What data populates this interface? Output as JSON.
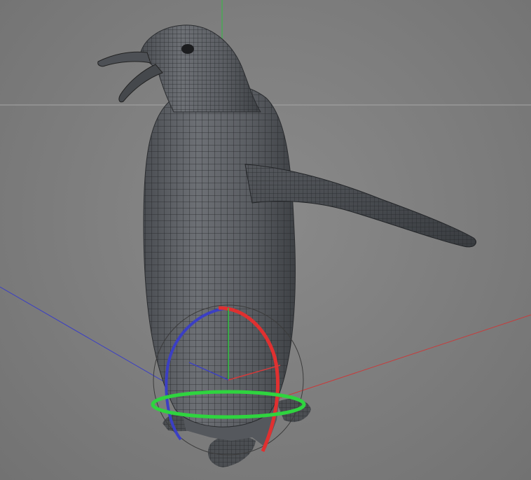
{
  "viewport": {
    "background_color": "#7c7c7c",
    "object": "penguin",
    "shading": "wireframe-on-shaded",
    "axis_colors": {
      "x": "#d63a3a",
      "y": "#2fbf3f",
      "z": "#3b3fc4"
    },
    "gizmo": "rotate-gizmo"
  }
}
